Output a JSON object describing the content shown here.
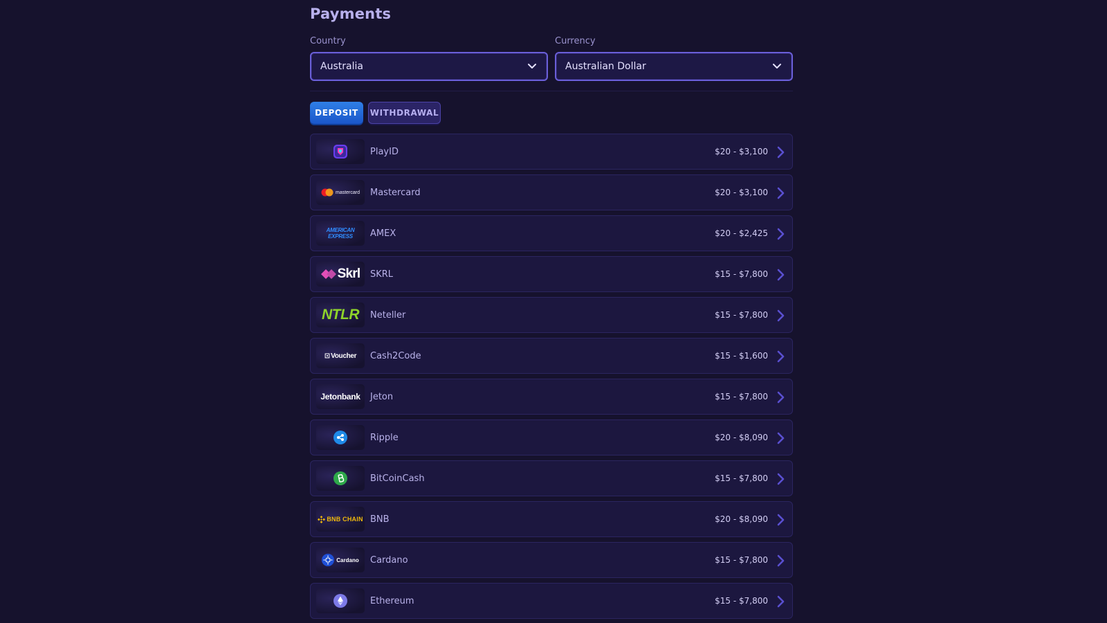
{
  "page": {
    "title": "Payments"
  },
  "country": {
    "label": "Country",
    "value": "Australia"
  },
  "currency": {
    "label": "Currency",
    "value": "Australian Dollar"
  },
  "tabs": {
    "deposit": "DEPOSIT",
    "withdrawal": "WITHDRAWAL",
    "active": "deposit"
  },
  "colors": {
    "background": "#16122d",
    "accent": "#6a5fd8",
    "deposit_tab": "#2f7fe6",
    "row_bg": "#1c173f"
  },
  "methods": [
    {
      "name": "PlayID",
      "range": "$20 - $3,100",
      "icon": "playid-logo-icon"
    },
    {
      "name": "Mastercard",
      "range": "$20 - $3,100",
      "icon": "mastercard-logo-icon",
      "logo_text": "mastercard"
    },
    {
      "name": "AMEX",
      "range": "$20 - $2,425",
      "icon": "amex-logo-icon",
      "logo_text": "AMERICAN EXPRESS"
    },
    {
      "name": "SKRL",
      "range": "$15 - $7,800",
      "icon": "skrill-logo-icon",
      "logo_text": "Skrl"
    },
    {
      "name": "Neteller",
      "range": "$15 - $7,800",
      "icon": "neteller-logo-icon",
      "logo_text": "NTLR"
    },
    {
      "name": "Cash2Code",
      "range": "$15 - $1,600",
      "icon": "voucher-logo-icon",
      "logo_text": "Voucher"
    },
    {
      "name": "Jeton",
      "range": "$15 - $7,800",
      "icon": "jetonbank-logo-icon",
      "logo_text": "Jetonbank"
    },
    {
      "name": "Ripple",
      "range": "$20 - $8,090",
      "icon": "ripple-logo-icon"
    },
    {
      "name": "BitCoinCash",
      "range": "$15 - $7,800",
      "icon": "bitcoincash-logo-icon"
    },
    {
      "name": "BNB",
      "range": "$20 - $8,090",
      "icon": "bnb-chain-logo-icon",
      "logo_text": "BNB CHAIN"
    },
    {
      "name": "Cardano",
      "range": "$15 - $7,800",
      "icon": "cardano-logo-icon",
      "logo_text": "Cardano"
    },
    {
      "name": "Ethereum",
      "range": "$15 - $7,800",
      "icon": "ethereum-logo-icon"
    }
  ]
}
